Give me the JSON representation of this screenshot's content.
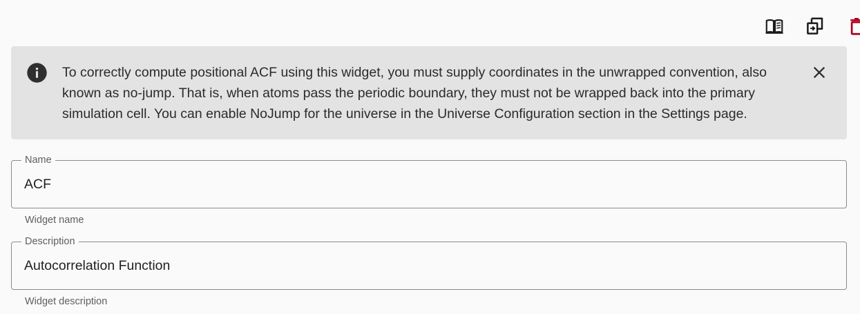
{
  "toolbar": {
    "docs_icon": "book-open-icon",
    "duplicate_icon": "duplicate-icon",
    "delete_icon": "trash-icon",
    "delete_color": "#b00020"
  },
  "alert": {
    "icon": "info-icon",
    "text": "To correctly compute positional ACF using this widget, you must supply coordinates in the unwrapped convention, also known as no-jump. That is, when atoms pass the periodic boundary, they must not be wrapped back into the primary simulation cell. You can enable NoJump for the universe in the Universe Configuration section in the Settings page.",
    "close_icon": "close-icon",
    "background": "#e3e3e3"
  },
  "form": {
    "name": {
      "label": "Name",
      "value": "ACF",
      "helper": "Widget name"
    },
    "description": {
      "label": "Description",
      "value": "Autocorrelation Function",
      "helper": "Widget description"
    }
  }
}
